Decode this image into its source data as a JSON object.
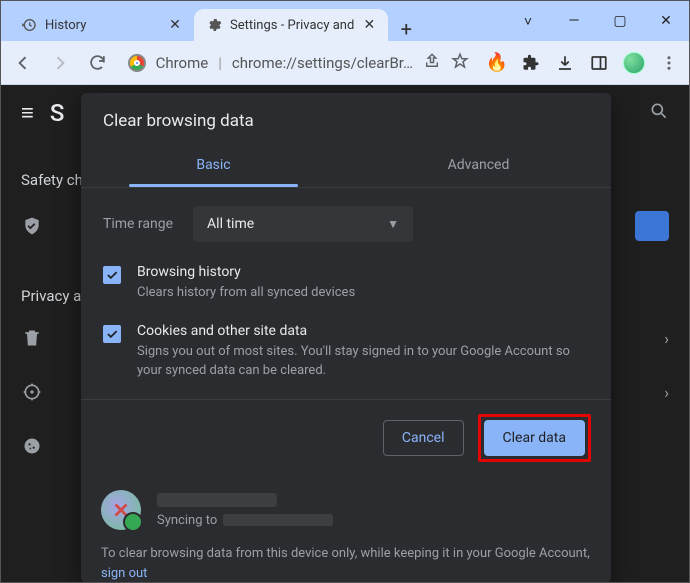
{
  "window": {
    "tabs": [
      {
        "title": "History",
        "active": false
      },
      {
        "title": "Settings - Privacy and",
        "active": true
      }
    ],
    "controls": {
      "minimize": "—",
      "maximize": "▢",
      "close": "✕",
      "down": "˅"
    }
  },
  "toolbar": {
    "omnibox_prefix": "Chrome",
    "omnibox_url": "chrome://settings/clearBr…"
  },
  "bg": {
    "app_initial": "S",
    "section1": "Safety ch",
    "section2": "Privacy a"
  },
  "dialog": {
    "title": "Clear browsing data",
    "tabs": {
      "basic": "Basic",
      "advanced": "Advanced"
    },
    "time_range_label": "Time range",
    "time_range_value": "All time",
    "items": [
      {
        "title": "Browsing history",
        "desc": "Clears history from all synced devices",
        "checked": true
      },
      {
        "title": "Cookies and other site data",
        "desc": "Signs you out of most sites. You'll stay signed in to your Google Account so your synced data can be cleared.",
        "checked": true
      }
    ],
    "buttons": {
      "cancel": "Cancel",
      "confirm": "Clear data"
    },
    "sync_label": "Syncing to",
    "note_text": "To clear browsing data from this device only, while keeping it in your Google Account, ",
    "note_link": "sign out"
  }
}
